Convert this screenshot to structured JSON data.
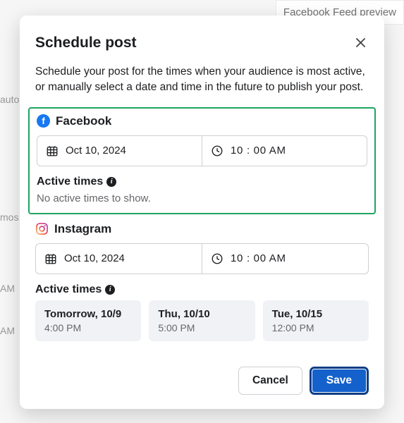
{
  "background": {
    "preview_label": "Facebook Feed preview",
    "auto": "auto",
    "mos": "mos",
    "am1": "AM",
    "am2": "AM"
  },
  "modal": {
    "title": "Schedule post",
    "description": "Schedule your post for the times when your audience is most active, or manually select a date and time in the future to publish your post.",
    "cancel": "Cancel",
    "save": "Save"
  },
  "facebook": {
    "label": "Facebook",
    "date": "Oct 10, 2024",
    "time": "10 : 00 AM",
    "active_times_label": "Active times",
    "no_active": "No active times to show."
  },
  "instagram": {
    "label": "Instagram",
    "date": "Oct 10, 2024",
    "time": "10 : 00 AM",
    "active_times_label": "Active times",
    "slots": [
      {
        "date": "Tomorrow, 10/9",
        "time": "4:00 PM"
      },
      {
        "date": "Thu, 10/10",
        "time": "5:00 PM"
      },
      {
        "date": "Tue, 10/15",
        "time": "12:00 PM"
      }
    ]
  }
}
